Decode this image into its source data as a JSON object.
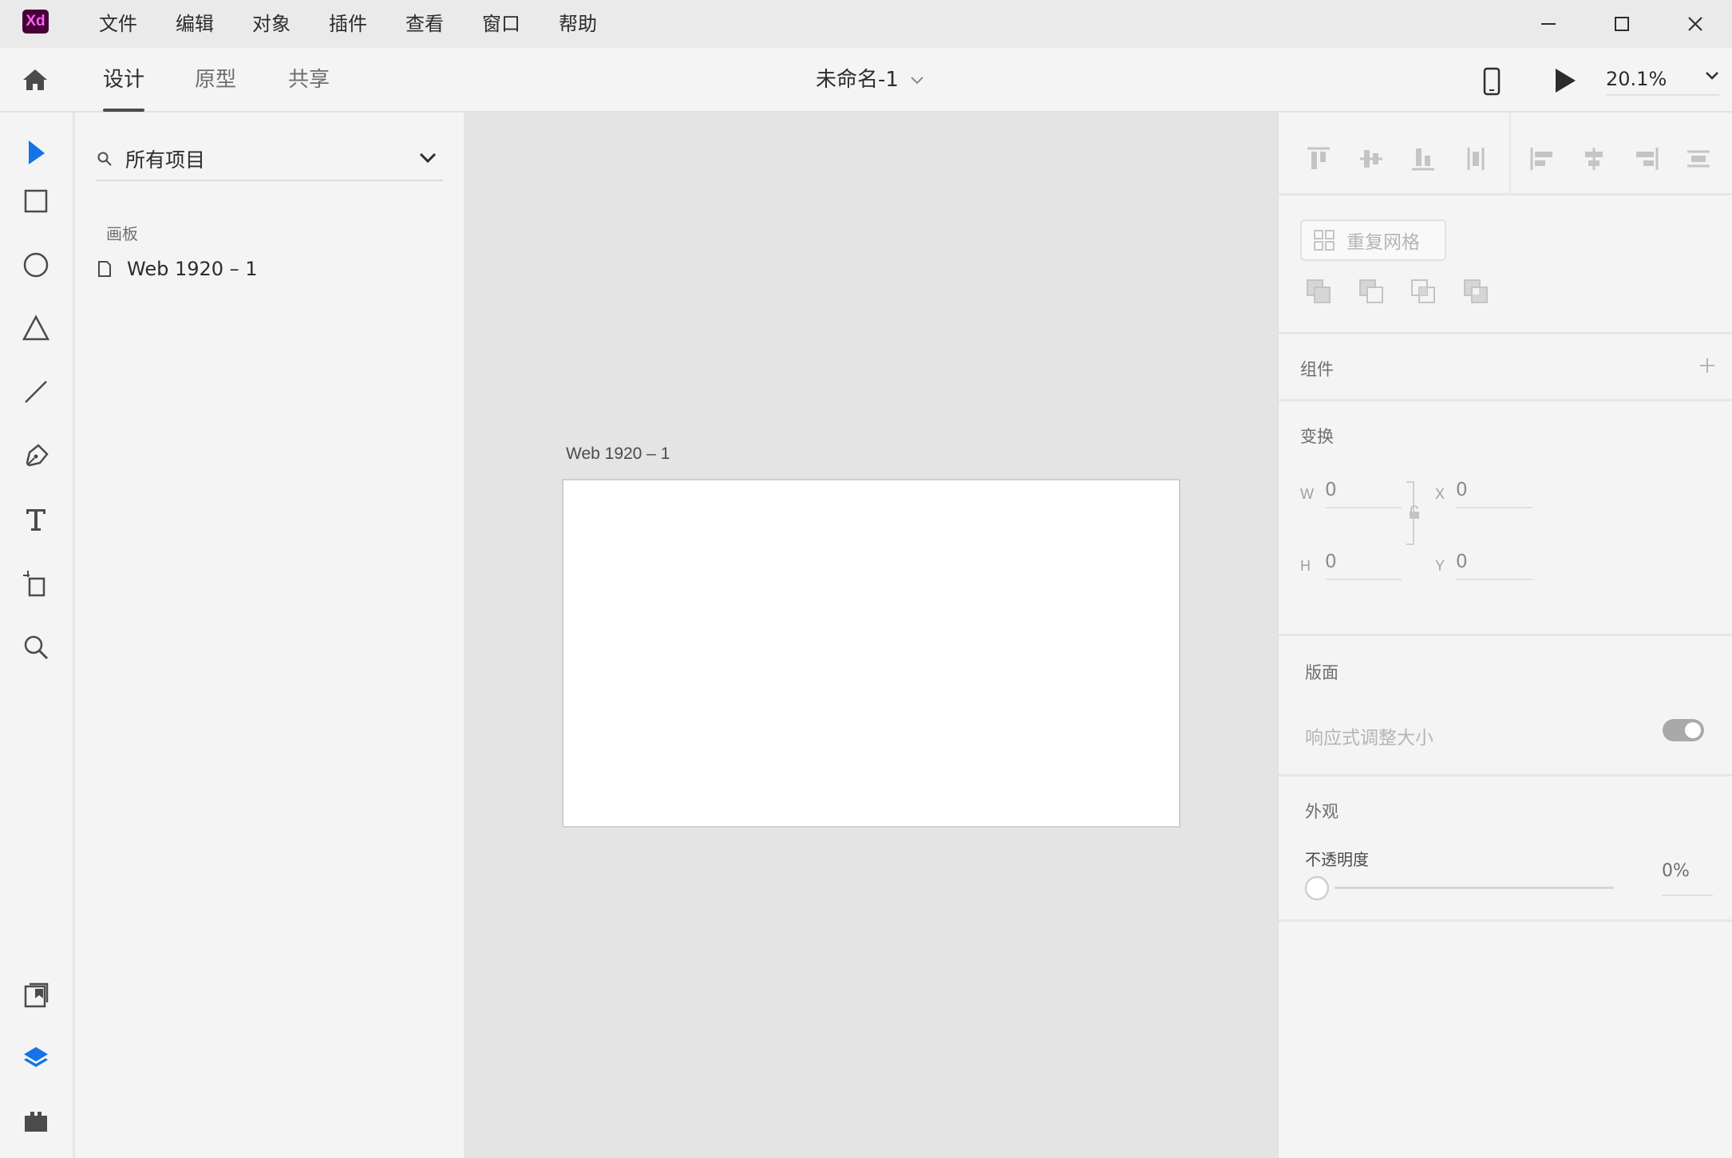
{
  "app": {
    "logo_text": "Xd",
    "brand_color": "#470137",
    "brand_text_color": "#ff61f6"
  },
  "menu": [
    "文件",
    "编辑",
    "对象",
    "插件",
    "查看",
    "窗口",
    "帮助"
  ],
  "window_controls": [
    "minimize-icon",
    "maximize-icon",
    "close-icon"
  ],
  "tabs": [
    {
      "label": "设计",
      "active": true
    },
    {
      "label": "原型",
      "active": false
    },
    {
      "label": "共享",
      "active": false
    }
  ],
  "document": {
    "title": "未命名-1"
  },
  "zoom": {
    "value": "20.1%"
  },
  "tools": [
    "select-icon",
    "rectangle-icon",
    "ellipse-icon",
    "polygon-icon",
    "line-icon",
    "pen-icon",
    "text-icon",
    "artboard-icon",
    "zoom-icon"
  ],
  "bottom_tools": [
    "assets-icon",
    "layers-icon",
    "plugins-icon"
  ],
  "layers": {
    "filter_label": "所有项目",
    "section_label": "画板",
    "items": [
      {
        "label": "Web 1920 – 1"
      }
    ]
  },
  "canvas": {
    "artboard_label": "Web 1920 – 1",
    "background": "#e4e4e4"
  },
  "inspector": {
    "repeat_grid_label": "重复网格",
    "components_label": "组件",
    "transform_label": "变换",
    "w_label": "W",
    "w_value": "0",
    "h_label": "H",
    "h_value": "0",
    "x_label": "X",
    "x_value": "0",
    "y_label": "Y",
    "y_value": "0",
    "layout_label": "版面",
    "responsive_label": "响应式调整大小",
    "appearance_label": "外观",
    "opacity_label": "不透明度",
    "opacity_value": "0%",
    "accent_color": "#1473e6"
  }
}
